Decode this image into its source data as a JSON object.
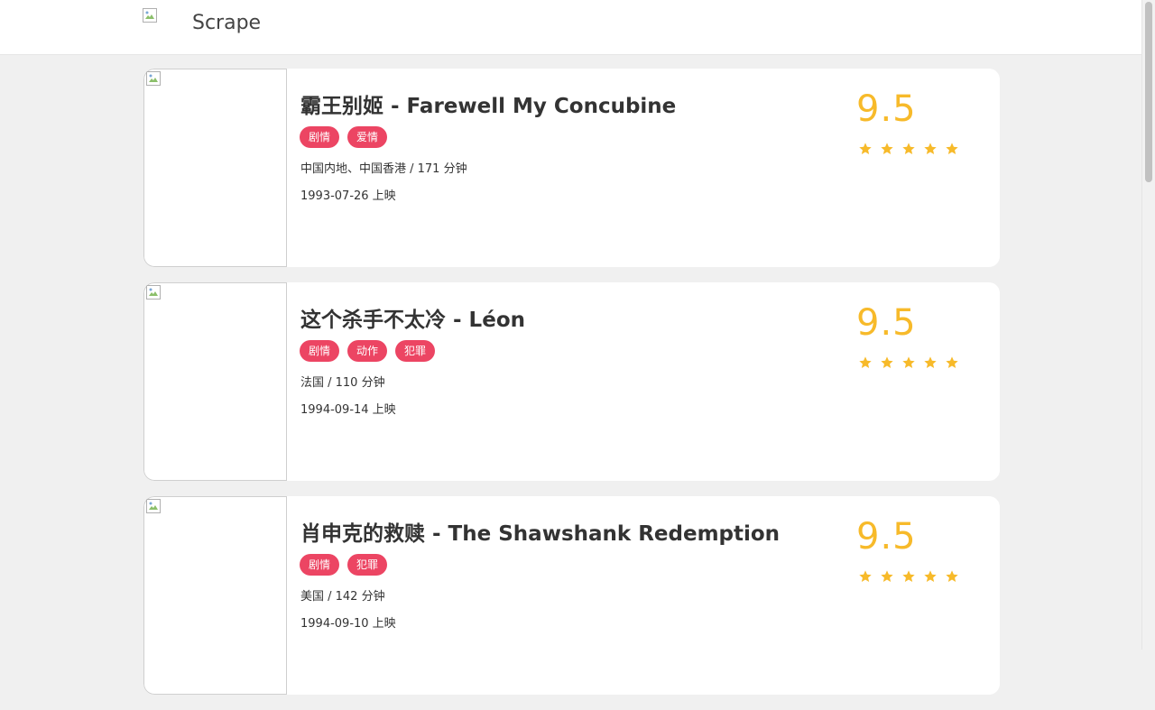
{
  "header": {
    "brand": "Scrape"
  },
  "colors": {
    "tag_bg": "#ec4563",
    "score": "#f7ba2a",
    "star": "#f7ba2a"
  },
  "movies": [
    {
      "title": "霸王别姬 - Farewell My Concubine",
      "tags": [
        "剧情",
        "爱情"
      ],
      "info": "中国内地、中国香港 / 171 分钟",
      "date": "1993-07-26 上映",
      "score": "9.5",
      "stars": 5
    },
    {
      "title": "这个杀手不太冷 - Léon",
      "tags": [
        "剧情",
        "动作",
        "犯罪"
      ],
      "info": "法国 / 110 分钟",
      "date": "1994-09-14 上映",
      "score": "9.5",
      "stars": 5
    },
    {
      "title": "肖申克的救赎 - The Shawshank Redemption",
      "tags": [
        "剧情",
        "犯罪"
      ],
      "info": "美国 / 142 分钟",
      "date": "1994-09-10 上映",
      "score": "9.5",
      "stars": 5
    }
  ]
}
